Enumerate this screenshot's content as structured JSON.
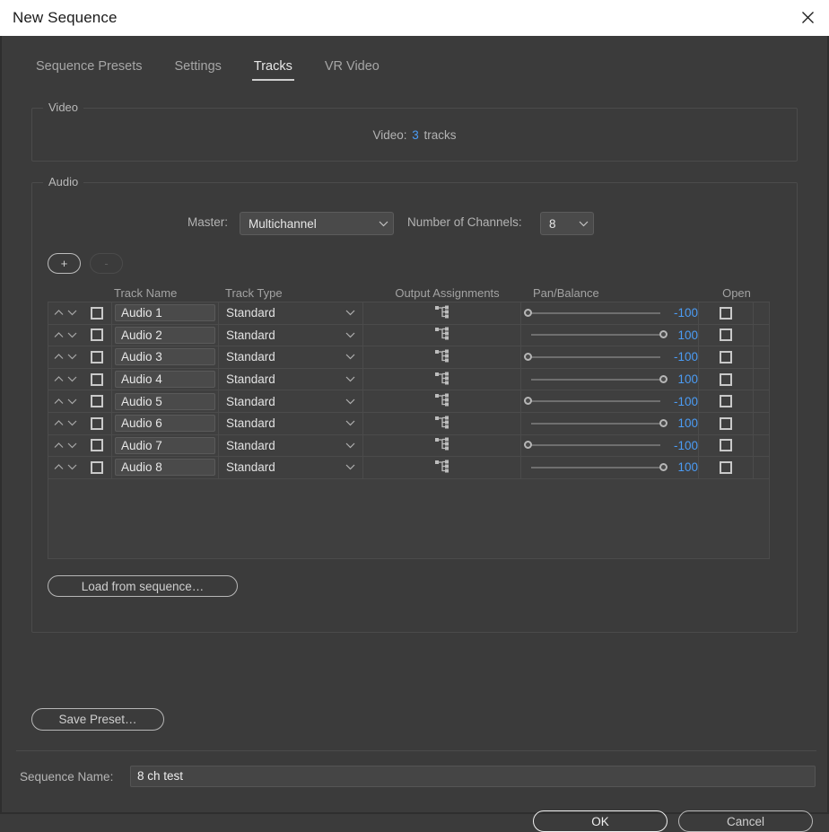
{
  "window": {
    "title": "New Sequence",
    "close_icon": "close-icon"
  },
  "tabs": [
    {
      "label": "Sequence Presets",
      "active": false
    },
    {
      "label": "Settings",
      "active": false
    },
    {
      "label": "Tracks",
      "active": true
    },
    {
      "label": "VR Video",
      "active": false
    }
  ],
  "video_group": {
    "legend": "Video",
    "field_label": "Video:",
    "value": "3",
    "suffix": "tracks"
  },
  "audio_group": {
    "legend": "Audio",
    "master_label": "Master:",
    "master_value": "Multichannel",
    "channels_label": "Number of Channels:",
    "channels_value": "8",
    "add_button": "+",
    "remove_button": "-",
    "load_from_sequence": "Load from sequence…",
    "columns": {
      "track_name": "Track Name",
      "track_type": "Track Type",
      "output_assignments": "Output Assignments",
      "pan_balance": "Pan/Balance",
      "open": "Open"
    },
    "rows": [
      {
        "name": "Audio 1",
        "type": "Standard",
        "output_icon": "routing-icon",
        "pan": "-100",
        "pan_side": "left",
        "open": false
      },
      {
        "name": "Audio 2",
        "type": "Standard",
        "output_icon": "routing-icon",
        "pan": "100",
        "pan_side": "right",
        "open": false
      },
      {
        "name": "Audio 3",
        "type": "Standard",
        "output_icon": "routing-icon",
        "pan": "-100",
        "pan_side": "left",
        "open": false
      },
      {
        "name": "Audio 4",
        "type": "Standard",
        "output_icon": "routing-icon",
        "pan": "100",
        "pan_side": "right",
        "open": false
      },
      {
        "name": "Audio 5",
        "type": "Standard",
        "output_icon": "routing-icon",
        "pan": "-100",
        "pan_side": "left",
        "open": false
      },
      {
        "name": "Audio 6",
        "type": "Standard",
        "output_icon": "routing-icon",
        "pan": "100",
        "pan_side": "right",
        "open": false
      },
      {
        "name": "Audio 7",
        "type": "Standard",
        "output_icon": "routing-icon",
        "pan": "-100",
        "pan_side": "left",
        "open": false
      },
      {
        "name": "Audio 8",
        "type": "Standard",
        "output_icon": "routing-icon",
        "pan": "100",
        "pan_side": "right",
        "open": false
      }
    ]
  },
  "footer": {
    "save_preset": "Save Preset…",
    "sequence_name_label": "Sequence Name:",
    "sequence_name_value": "8 ch test",
    "ok": "OK",
    "cancel": "Cancel"
  },
  "colors": {
    "accent_blue": "#4b9cf5",
    "dialog_bg": "#3b3b3b",
    "titlebar_bg": "#ffffff",
    "field_bg": "#4a4a4a",
    "border": "#4b4b4b"
  }
}
